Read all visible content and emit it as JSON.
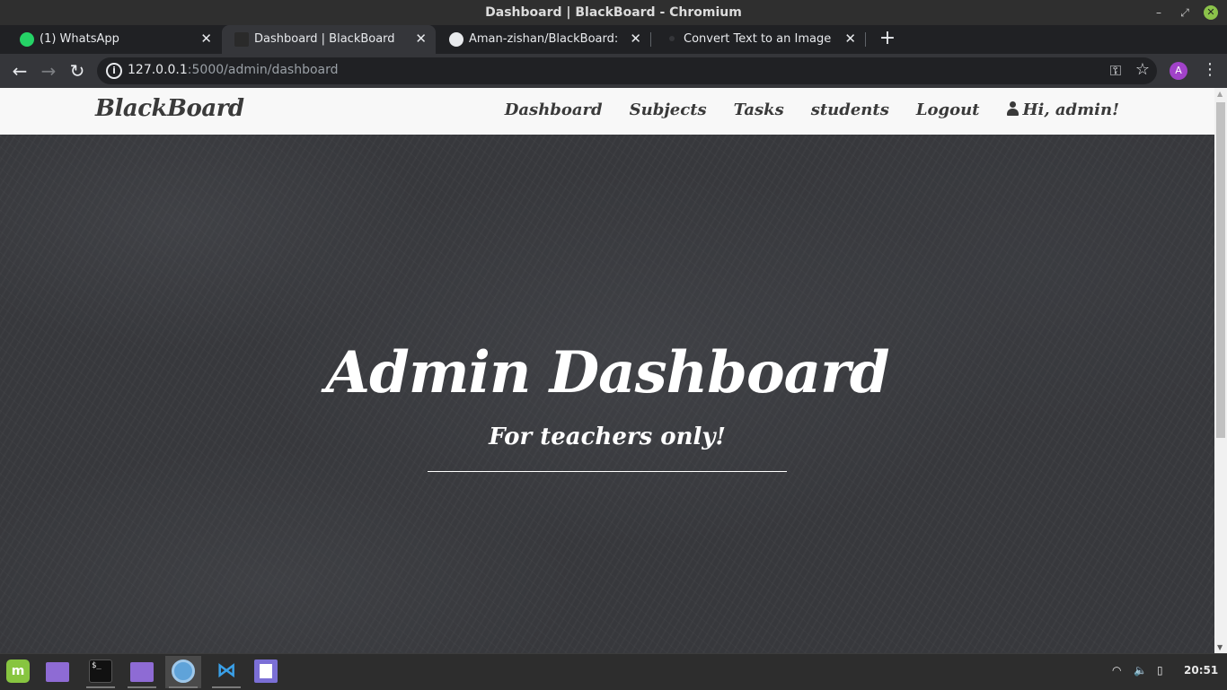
{
  "window": {
    "title": "Dashboard | BlackBoard - Chromium",
    "min_glyph": "–",
    "max_glyph": "⤢",
    "close_glyph": "✕"
  },
  "tabs": [
    {
      "label": "(1) WhatsApp",
      "icon": "whatsapp-icon",
      "active": false,
      "close": "✕"
    },
    {
      "label": "Dashboard | BlackBoard",
      "icon": "blackboard-favicon-icon",
      "active": true,
      "close": "✕"
    },
    {
      "label": "Aman-zishan/BlackBoard: class",
      "icon": "github-icon",
      "active": false,
      "close": "✕"
    },
    {
      "label": "Convert Text to an Image - Onli",
      "icon": "page-favicon-icon",
      "active": false,
      "close": "✕"
    }
  ],
  "new_tab_glyph": "+",
  "toolbar": {
    "back_glyph": "←",
    "forward_glyph": "→",
    "reload_glyph": "↻",
    "url_host": "127.0.0.1",
    "url_rest": ":5000/admin/dashboard",
    "info_glyph": "i",
    "key_glyph": "⚿",
    "star_glyph": "☆",
    "profile_initial": "A",
    "menu_glyph": "⋮"
  },
  "site": {
    "brand": "BlackBoard",
    "nav": {
      "dashboard": "Dashboard",
      "subjects": "Subjects",
      "tasks": "Tasks",
      "students": "students",
      "logout": "Logout",
      "user_greeting": "Hi, admin!"
    },
    "hero": {
      "title": "Admin Dashboard",
      "subtitle": "For teachers only!"
    }
  },
  "scrollbar": {
    "up_glyph": "▲",
    "down_glyph": "▼"
  },
  "taskbar": {
    "mint_glyph": "m",
    "terminal_glyph": "$_",
    "vscode_glyph": "⋈",
    "wifi_glyph": "◠",
    "volume_glyph": "🔈",
    "battery_glyph": "▯",
    "clock": "20:51"
  }
}
